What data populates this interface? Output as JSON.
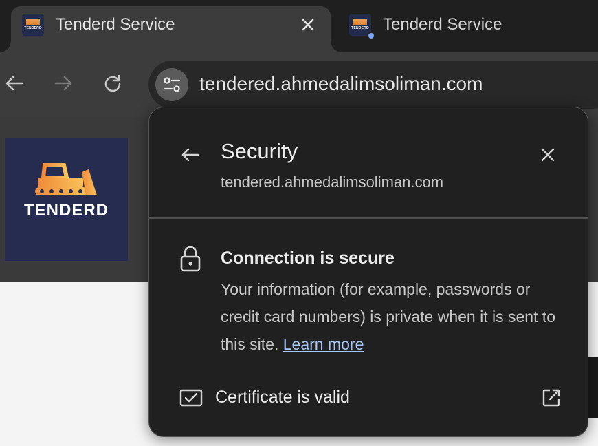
{
  "tabs": [
    {
      "title": "Tenderd Service",
      "favicon_text": "TENDERD",
      "active": true
    },
    {
      "title": "Tenderd Service",
      "favicon_text": "TENDERD",
      "active": false
    }
  ],
  "toolbar": {
    "url": "tendered.ahmedalimsoliman.com"
  },
  "page": {
    "logo_text": "TENDERD",
    "logo_bg": "#252c4f",
    "accent_orange": "#f0a64a"
  },
  "security_popup": {
    "title": "Security",
    "domain": "tendered.ahmedalimsoliman.com",
    "connection_title": "Connection is secure",
    "connection_desc": "Your information (for example, passwords or credit card numbers) is private when it is sent to this site.",
    "learn_more": "Learn more",
    "certificate_label": "Certificate is valid"
  },
  "icons": {
    "back": "arrow-left-icon",
    "forward": "arrow-right-icon",
    "reload": "reload-icon",
    "site_info": "tune-icon",
    "close": "close-icon",
    "lock": "lock-icon",
    "certificate": "certificate-icon",
    "external": "open-in-new-icon"
  }
}
